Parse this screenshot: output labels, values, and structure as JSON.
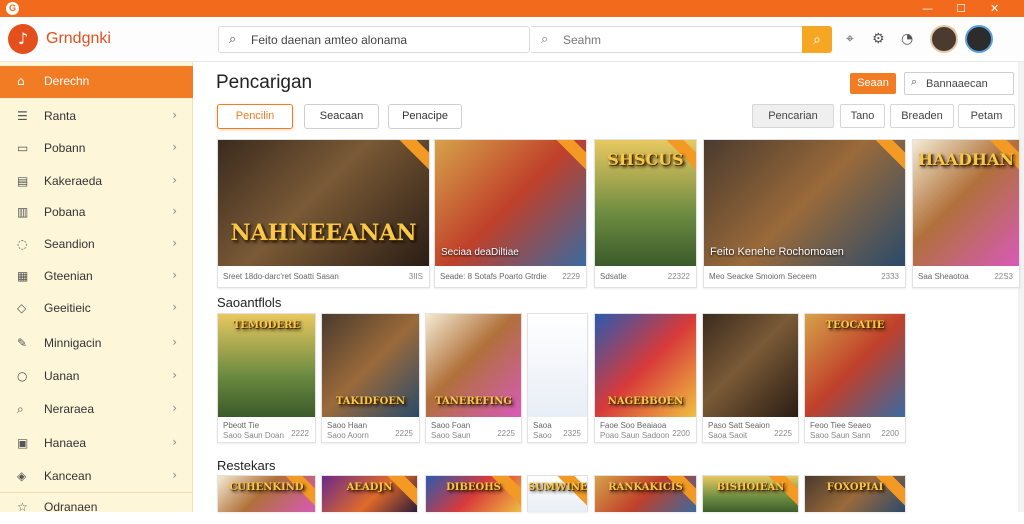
{
  "window": {
    "minimize": "—",
    "maximize": "☐",
    "close": "✕"
  },
  "header": {
    "app_name": "Grndgnki",
    "search_main": "Feito daenan amteo alonama",
    "search_secondary": "Seahm"
  },
  "sidebar": {
    "items": [
      {
        "label": "Derechn",
        "icon": "home-icon",
        "glyph": "⌂",
        "chevron": ""
      },
      {
        "label": "Ranta",
        "icon": "list-icon",
        "glyph": "☰",
        "chevron": "›"
      },
      {
        "label": "Pobann",
        "icon": "folder-icon",
        "glyph": "▭",
        "chevron": "›"
      },
      {
        "label": "Kakeraeda",
        "icon": "grid-icon",
        "glyph": "▤",
        "chevron": "›"
      },
      {
        "label": "Pobana",
        "icon": "document-icon",
        "glyph": "▥",
        "chevron": "›"
      },
      {
        "label": "Seandion",
        "icon": "chat-icon",
        "glyph": "◌",
        "chevron": "›"
      },
      {
        "label": "Gteenian",
        "icon": "calendar-icon",
        "glyph": "▦",
        "chevron": "›"
      },
      {
        "label": "Geeitieic",
        "icon": "shield-icon",
        "glyph": "◇",
        "chevron": "›"
      },
      {
        "label": "Minnigacin",
        "icon": "edit-icon",
        "glyph": "✎",
        "chevron": "›"
      },
      {
        "label": "Uanan",
        "icon": "user-icon",
        "glyph": "○",
        "chevron": "›"
      },
      {
        "label": "Neraraea",
        "icon": "search-icon",
        "glyph": "⌕",
        "chevron": "›"
      },
      {
        "label": "Hanaea",
        "icon": "settings-icon",
        "glyph": "▣",
        "chevron": "›"
      },
      {
        "label": "Kancean",
        "icon": "tag-icon",
        "glyph": "◈",
        "chevron": "›"
      },
      {
        "label": "Odranaen",
        "icon": "star-icon",
        "glyph": "☆",
        "chevron": ""
      }
    ]
  },
  "main": {
    "title": "Pencarigan",
    "action_button": "Seaan",
    "small_search": "Bannaaecan",
    "tabs": [
      "Pencilin",
      "Seacaan",
      "Penacipe"
    ],
    "filters": [
      "Pencarian",
      "Tano",
      "Breaden",
      "Petam"
    ]
  },
  "featured": [
    {
      "title": "NAHNEEANAN",
      "overlay": "",
      "meta": "Sreet 18do-darc'ret Soatti Sasan",
      "value": "3IIS"
    },
    {
      "title": "",
      "overlay": "Seciaa deaDiltiae",
      "meta": "Seade: 8 Sotafs Poarto Gtrdie",
      "value": "2229"
    },
    {
      "title": "SHSCUS",
      "overlay": "",
      "meta": "Sdsatle",
      "value": "22322"
    },
    {
      "title": "",
      "overlay": "Feito Kenehe Rochomoaen",
      "meta": "Meo Seacke Smoiom Seceem",
      "value": "2333"
    },
    {
      "title": "HAADHAN",
      "overlay": "",
      "meta": "Saa Sheaotoa",
      "value": "22S3"
    }
  ],
  "section2": {
    "title": "Saoantflols",
    "cards": [
      {
        "title": "TEMODERE",
        "meta": "Pbeott Tie",
        "meta2": "Saoo Saun Doan",
        "value": "2222"
      },
      {
        "title": "TAKIDFOEN",
        "meta": "Saoo Haan",
        "meta2": "Saoo Aoorn",
        "value": "2225"
      },
      {
        "title": "TANEREFING",
        "meta": "Saoo Foan",
        "meta2": "Saoo Saun",
        "value": "2225"
      },
      {
        "title": "",
        "meta": "Saoa",
        "meta2": "Saoo",
        "value": "2325"
      },
      {
        "title": "NAGEBBOEN",
        "meta": "Faoe Soo Beaiaoa",
        "meta2": "Poao Saun Sadoon",
        "value": "2200"
      },
      {
        "title": "",
        "meta": "Paso Satt Seaion",
        "meta2": "Saoa Saoit",
        "value": "2225"
      },
      {
        "title": "TEOCATIE",
        "meta": "Feoo Tiee Seaeo",
        "meta2": "Saoo Saun Sann",
        "value": "2200"
      }
    ]
  },
  "section3": {
    "title": "Restekars",
    "cards": [
      {
        "title": "CUHENKIND"
      },
      {
        "title": "AEADJN"
      },
      {
        "title": "DIBEOHS"
      },
      {
        "title": "SUMWINE"
      },
      {
        "title": "RANKAKICIS"
      },
      {
        "title": "BISHOIEAN"
      },
      {
        "title": "FOXOPIAI"
      }
    ]
  },
  "colors": {
    "accent": "#f27c23",
    "brand": "#e3501c",
    "sidebar_bg": "#fdf6d9"
  }
}
